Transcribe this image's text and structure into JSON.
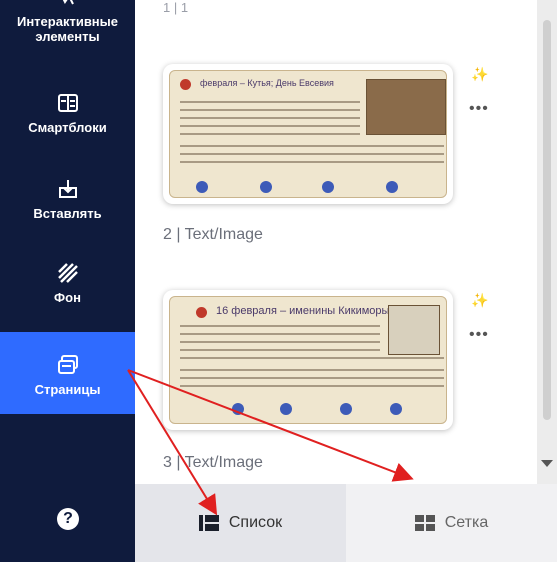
{
  "sidebar": {
    "items": [
      {
        "label": "Интерактивные элементы",
        "icon": "interactive-icon"
      },
      {
        "label": "Смартблоки",
        "icon": "smartblocks-icon"
      },
      {
        "label": "Вставлять",
        "icon": "insert-icon"
      },
      {
        "label": "Фон",
        "icon": "background-icon"
      },
      {
        "label": "Страницы",
        "icon": "pages-icon",
        "active": true
      }
    ],
    "help": "?"
  },
  "pages": {
    "top_label": "1 | 1",
    "items": [
      {
        "label": "2 | Text/Image",
        "title": "февраля – Кутья; День Евсевия"
      },
      {
        "label": "3 | Text/Image",
        "title": "16 февраля – именины Кикиморы"
      }
    ]
  },
  "view_toggle": {
    "list_label": "Список",
    "grid_label": "Сетка"
  },
  "colors": {
    "sidebar_bg": "#0f1b3d",
    "active_bg": "#2f6bff",
    "arrow": "#e02020"
  }
}
